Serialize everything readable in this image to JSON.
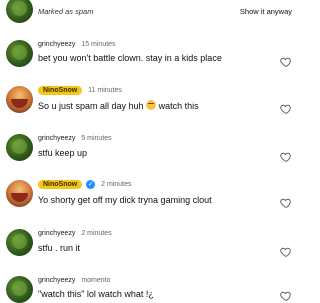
{
  "spam_row": {
    "label": "Marked as spam",
    "action": "Show it anyway"
  },
  "comments": [
    {
      "username": "grinchyeezy",
      "time": "15 minutes",
      "text": "bet you won't battle clown. stay in a kids place",
      "avatar": "green-avatar"
    },
    {
      "username": "NinoSnow",
      "time": "11 minutes",
      "text_before": "So u just spam all day huh",
      "text_after": "watch this",
      "avatar": "cartoon-avatar",
      "badge": true
    },
    {
      "username": "grinchyeezy",
      "time": "5 minutes",
      "text": "stfu keep up",
      "avatar": "green-avatar"
    },
    {
      "username": "NinoSnow",
      "time": "2 minutes",
      "text": "Yo shorty get off my dick tryna gaming clout",
      "avatar": "cartoon-avatar",
      "badge": true,
      "verified": true
    },
    {
      "username": "grinchyeezy",
      "time": "2 minutes",
      "text": "stfu . run it",
      "avatar": "green-avatar"
    },
    {
      "username": "grinchyeezy",
      "time": "momento",
      "text": "\"watch this\" lol watch what !¿",
      "avatar": "green-avatar"
    }
  ],
  "icons": {
    "like": "heart-outline-icon",
    "verified": "verified-check-icon",
    "emoji": "smirk-emoji-icon"
  },
  "colors": {
    "badge": "#f5c518",
    "verified": "#1e90ff"
  }
}
